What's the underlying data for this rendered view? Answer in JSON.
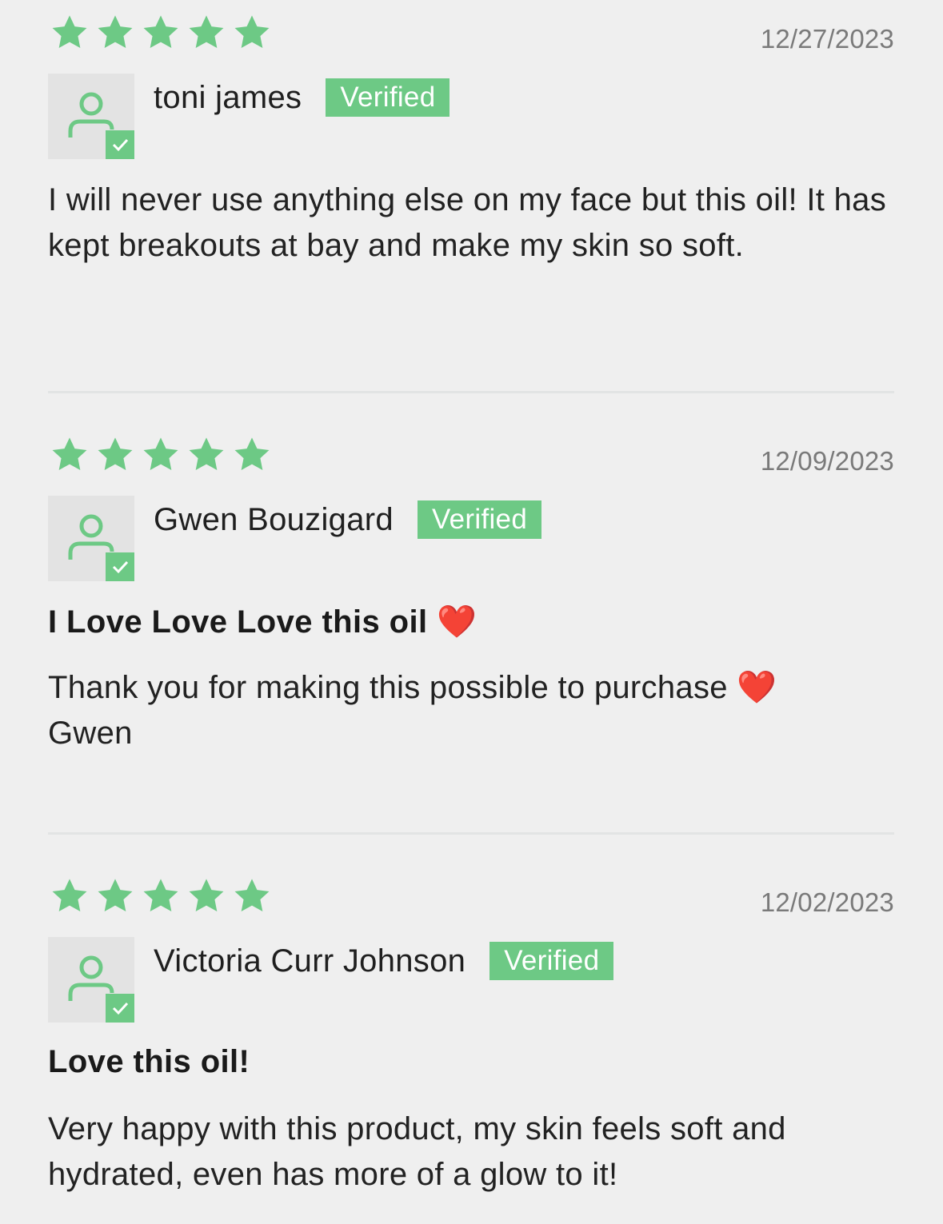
{
  "colors": {
    "accent_green": "#6dc985",
    "background": "#efefef",
    "avatar_bg": "#e3e3e3",
    "date_text": "#7a7a7a"
  },
  "icons": {
    "rating_star": "star-icon",
    "avatar": "user-avatar-icon",
    "verified_check": "check-icon"
  },
  "reviews": [
    {
      "rating": 5,
      "date": "12/27/2023",
      "author": "toni james",
      "badge": "Verified",
      "title": "",
      "body": "I will never use anything else on my face but this oil! It has kept breakouts at bay and make my skin so soft."
    },
    {
      "rating": 5,
      "date": "12/09/2023",
      "author": "Gwen Bouzigard",
      "badge": "Verified",
      "title": "I Love Love Love this oil ❤️",
      "body": "Thank you for making this possible to purchase ❤️ Gwen"
    },
    {
      "rating": 5,
      "date": "12/02/2023",
      "author": "Victoria Curr Johnson",
      "badge": "Verified",
      "title": "Love this oil!",
      "body": "Very happy with this product, my skin feels soft and hydrated, even has more of a glow to it!"
    }
  ]
}
